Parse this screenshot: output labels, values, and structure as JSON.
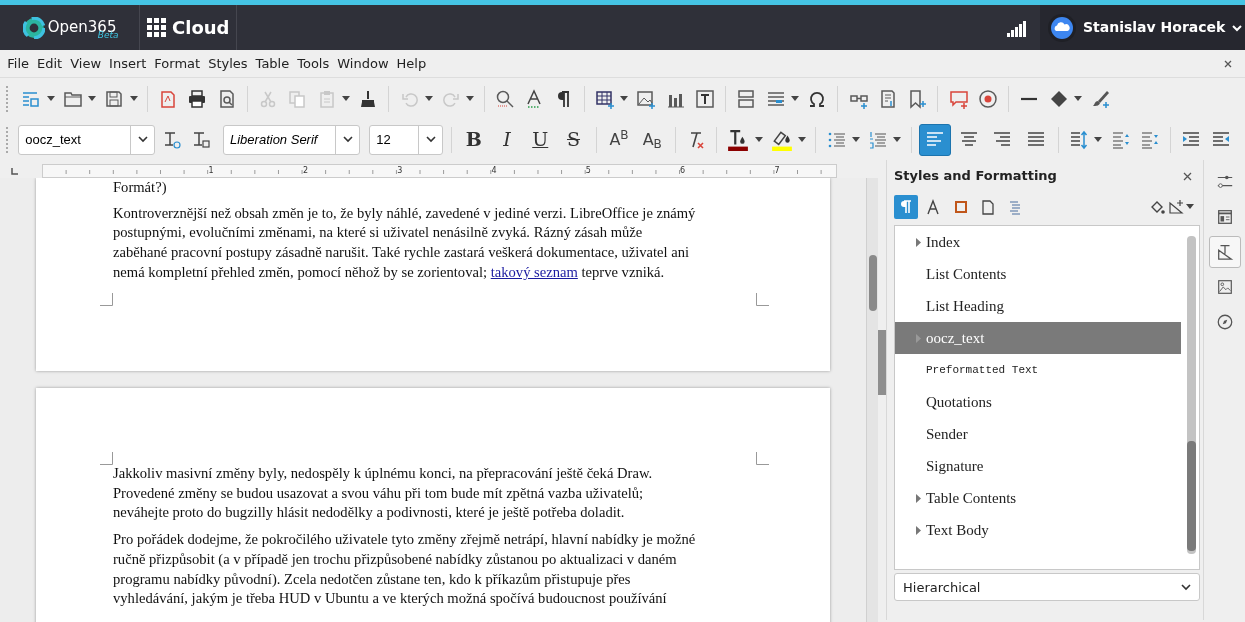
{
  "header": {
    "logo": "Open365",
    "logo_badge": "Beta",
    "app": "Cloud",
    "user": "Stanislav Horacek"
  },
  "menu": [
    "File",
    "Edit",
    "View",
    "Insert",
    "Format",
    "Styles",
    "Table",
    "Tools",
    "Window",
    "Help"
  ],
  "format_bar": {
    "paragraph_style": "oocz_text",
    "font_name": "Liberation Serif",
    "font_size": "12",
    "text_buttons": [
      {
        "label": "B",
        "kind": "bold"
      },
      {
        "label": "I",
        "kind": "italic"
      },
      {
        "label": "U",
        "kind": "underline"
      },
      {
        "label": "S",
        "kind": "strike"
      },
      {
        "label": "A$^{B}$",
        "kind": "super"
      },
      {
        "label": "A$_{B}$",
        "kind": "sub"
      }
    ],
    "color_buttons": [
      {
        "kind": "font",
        "color": "#8b0000"
      },
      {
        "kind": "highlight",
        "color": "#ffff00"
      }
    ],
    "alignment": [
      {
        "kind": "left",
        "selected": true
      },
      {
        "kind": "center",
        "selected": false
      },
      {
        "kind": "right",
        "selected": false
      },
      {
        "kind": "justify",
        "selected": false
      }
    ]
  },
  "ruler": {
    "labels": [
      "1",
      "2",
      "3",
      "4",
      "5",
      "6",
      "7"
    ]
  },
  "pages": [
    {
      "paragraphs": [
        {
          "runs": [
            {
              "text": "Formát?)"
            }
          ]
        },
        {
          "runs": [
            {
              "text": "Kontroverznější než obsah změn je to, že byly náhlé, zavedené v jediné verzi. LibreOffice je známý\npostupnými, evolučními změnami, na které si uživatel nenásilně zvyká. Rázný zásah může\nzaběhané pracovní postupy zásadně narušit. Také rychle zastará veškerá dokumentace, uživatel ani\nnemá kompletní přehled změn, pomocí něhož by se zorientoval; "
            },
            {
              "text": "takový seznam",
              "link": true
            },
            {
              "text": " teprve vzniká."
            }
          ]
        }
      ]
    },
    {
      "paragraphs": [
        {
          "runs": [
            {
              "text": "Jakkoliv masivní změny byly, nedospěly k úplnému konci, na přepracování ještě čeká Draw.\nProvedené změny se budou usazovat a svou váhu při tom bude mít zpětná vazba uživatelů;\nneváhejte proto do bugzilly hlásit nedodělky a podivnosti, které je ještě potřeba doladit."
            }
          ]
        },
        {
          "runs": [
            {
              "text": "Pro pořádek dodejme, že pokročilého uživatele tyto změny zřejmě netrápí, hlavní nabídky je možné\nručně přizpůsobit (a v případě jen trochu přizpůsobené nabídky zůstanou po aktualizaci v daném\nprogramu nabídky původní). Zcela nedotčen zůstane ten, kdo k příkazům přistupuje přes\nvyhledávání, jakým je třeba HUD v Ubuntu a ve kterých možná spočívá budoucnost používání"
            }
          ]
        }
      ]
    }
  ],
  "sidebar": {
    "title": "Styles and Formatting",
    "families": [
      {
        "kind": "paragraph",
        "selected": true
      },
      {
        "kind": "character",
        "selected": false
      },
      {
        "kind": "frame",
        "selected": false
      },
      {
        "kind": "page",
        "selected": false
      },
      {
        "kind": "list",
        "selected": false
      }
    ],
    "styles": [
      {
        "name": "Index",
        "expandable": true,
        "selected": false,
        "kind": "serif"
      },
      {
        "name": "List Contents",
        "expandable": false,
        "selected": false,
        "kind": "serif"
      },
      {
        "name": "List Heading",
        "expandable": false,
        "selected": false,
        "kind": "serif"
      },
      {
        "name": "oocz_text",
        "expandable": true,
        "selected": true,
        "kind": "serif"
      },
      {
        "name": "Preformatted Text",
        "expandable": false,
        "selected": false,
        "kind": "mono"
      },
      {
        "name": "Quotations",
        "expandable": false,
        "selected": false,
        "kind": "serif"
      },
      {
        "name": "Sender",
        "expandable": false,
        "selected": false,
        "kind": "serif"
      },
      {
        "name": "Signature",
        "expandable": false,
        "selected": false,
        "kind": "serif"
      },
      {
        "name": "Table Contents",
        "expandable": true,
        "selected": false,
        "kind": "serif"
      },
      {
        "name": "Text Body",
        "expandable": true,
        "selected": false,
        "kind": "serif"
      }
    ],
    "filter": "Hierarchical",
    "deck": [
      {
        "kind": "properties",
        "selected": false
      },
      {
        "kind": "page",
        "selected": false
      },
      {
        "kind": "styles",
        "selected": true
      },
      {
        "kind": "gallery",
        "selected": false
      },
      {
        "kind": "navigator",
        "selected": false
      }
    ]
  }
}
